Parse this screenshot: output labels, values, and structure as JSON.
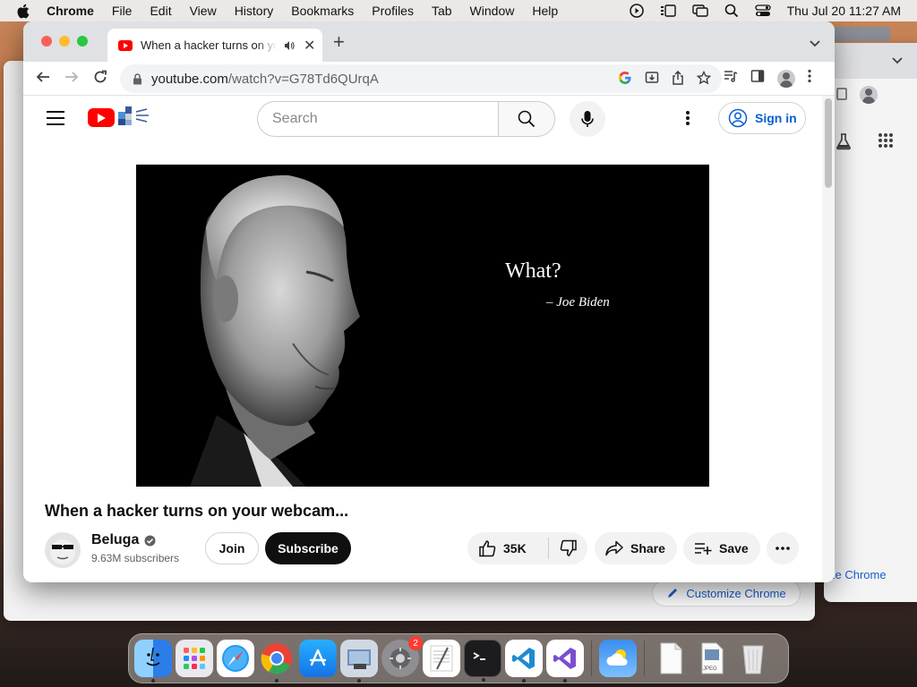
{
  "menubar": {
    "app_name": "Chrome",
    "menus": [
      "File",
      "Edit",
      "View",
      "History",
      "Bookmarks",
      "Profiles",
      "Tab",
      "Window",
      "Help"
    ],
    "clock": "Thu Jul 20  11:27 AM"
  },
  "browser": {
    "tab_title": "When a hacker turns on your webcam...",
    "url_host": "youtube.com",
    "url_path": "/watch?v=G78Td6QUrqA"
  },
  "youtube": {
    "search_placeholder": "Search",
    "sign_in_label": "Sign in",
    "video": {
      "quote": "What?",
      "quote_author": "– Joe Biden"
    },
    "video_title": "When a hacker turns on your webcam...",
    "channel": {
      "name": "Beluga",
      "subscribers": "9.63M subscribers",
      "join_label": "Join",
      "subscribe_label": "Subscribe"
    },
    "actions": {
      "likes": "35K",
      "share_label": "Share",
      "save_label": "Save"
    }
  },
  "background": {
    "customize_chrome_label": "Customize Chrome",
    "customize_chrome_partial": "ze Chrome"
  },
  "dock": {
    "items": [
      "finder",
      "launchpad",
      "safari",
      "chrome",
      "app-store",
      "preview",
      "system-settings",
      "textedit",
      "terminal",
      "vscode",
      "visual-studio",
      "weather",
      "document",
      "jpeg-file",
      "trash"
    ],
    "settings_badge": "2",
    "jpeg_label": "JPEG"
  },
  "colors": {
    "youtube_red": "#ff0000",
    "link_blue": "#065fd4",
    "chrome_tabstrip": "#dfe1e5"
  }
}
